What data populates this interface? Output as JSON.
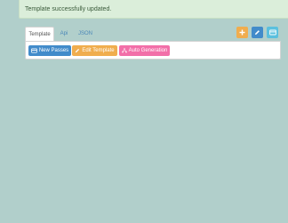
{
  "colors": {
    "background": "#b1cfcb",
    "alert_bg": "#dbeeda",
    "alert_border": "#c8e0c4",
    "alert_text": "#3a5a3a",
    "panel_bg": "#ffffff",
    "panel_border": "#d4d4d4",
    "tab_active_text": "#555555",
    "tab_link": "#4a87b8",
    "orange": "#f0ad4e",
    "blue": "#428bca",
    "cyan": "#5bc0de",
    "pink": "#f26fa8"
  },
  "alert": {
    "message": "Template successfully updated."
  },
  "tabs": [
    {
      "label": "Template",
      "active": true
    },
    {
      "label": "Api",
      "active": false
    },
    {
      "label": "JSON",
      "active": false
    }
  ],
  "toolbar_icons": [
    {
      "icon": "plus-icon",
      "color": "orange"
    },
    {
      "icon": "pencil-icon",
      "color": "blue"
    },
    {
      "icon": "card-icon",
      "color": "cyan"
    }
  ],
  "actions": {
    "new_passes": {
      "label": "New Passes",
      "icon": "card-icon",
      "color": "blue"
    },
    "edit_template": {
      "label": "Edit Template",
      "icon": "pencil-icon",
      "color": "orange"
    },
    "auto_generation": {
      "label": "Auto Generation",
      "icon": "sitemap-icon",
      "color": "pink"
    }
  }
}
